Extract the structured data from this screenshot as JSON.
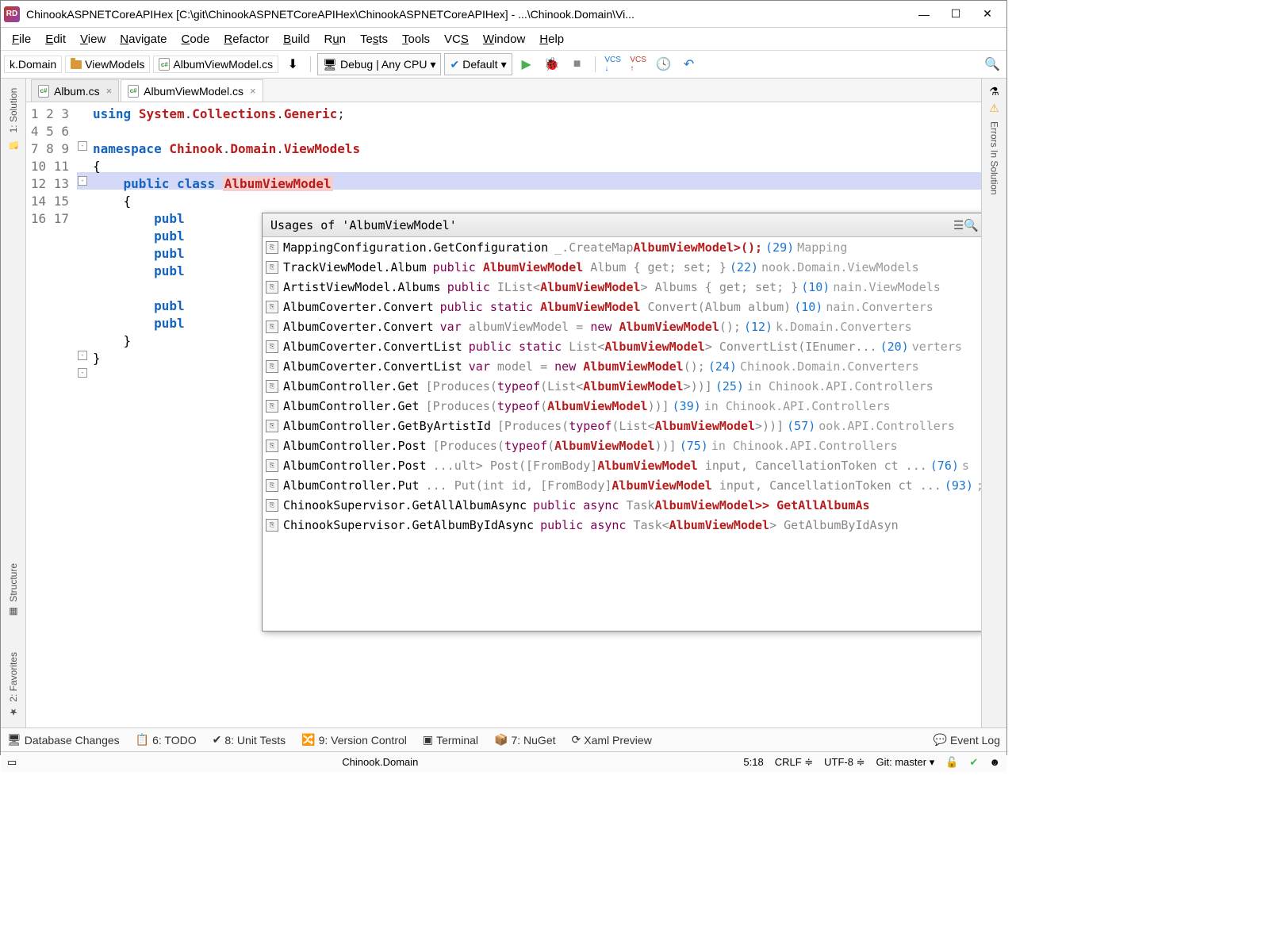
{
  "title": "ChinookASPNETCoreAPIHex [C:\\git\\ChinookASPNETCoreAPIHex\\ChinookASPNETCoreAPIHex] - ...\\Chinook.Domain\\Vi...",
  "menu": {
    "file": "File",
    "edit": "Edit",
    "view": "View",
    "navigate": "Navigate",
    "code": "Code",
    "refactor": "Refactor",
    "build": "Build",
    "run": "Run",
    "tests": "Tests",
    "tools": "Tools",
    "vcs": "VCS",
    "window": "Window",
    "help": "Help"
  },
  "breadcrumbs": {
    "seg1": "k.Domain",
    "seg2": "ViewModels",
    "seg3": "AlbumViewModel.cs"
  },
  "config": {
    "debug": "Debug | Any CPU",
    "default": "Default"
  },
  "tabs": {
    "t1": "Album.cs",
    "t2": "AlbumViewModel.cs"
  },
  "rails": {
    "solution": "1: Solution",
    "structure": "Structure",
    "favorites": "2: Favorites",
    "errors": "Errors In Solution"
  },
  "lines": [
    "1",
    "2",
    "3",
    "4",
    "5",
    "6",
    "7",
    "8",
    "9",
    "10",
    "11",
    "12",
    "13",
    "14",
    "15",
    "16",
    "17"
  ],
  "usages_title": "Usages of 'AlbumViewModel'",
  "usages": [
    {
      "name": "MappingConfiguration.GetConfiguration",
      "code": "_.CreateMap<Album, |AlbumViewModel|>();",
      "ln": "(29)",
      "path": "Mapping"
    },
    {
      "name": "TrackViewModel.Album",
      "code": "public |AlbumViewModel| Album { get; set; }",
      "ln": "(22)",
      "path": "nook.Domain.ViewModels"
    },
    {
      "name": "ArtistViewModel.Albums",
      "code": "public IList<|AlbumViewModel|> Albums { get; set; }",
      "ln": "(10)",
      "path": "nain.ViewModels"
    },
    {
      "name": "AlbumCoverter.Convert",
      "code": "public static |AlbumViewModel| Convert(Album album)",
      "ln": "(10)",
      "path": "nain.Converters"
    },
    {
      "name": "AlbumCoverter.Convert",
      "code": "var albumViewModel = new |AlbumViewModel|();",
      "ln": "(12)",
      "path": "k.Domain.Converters"
    },
    {
      "name": "AlbumCoverter.ConvertList",
      "code": "public static List<|AlbumViewModel|> ConvertList(IEnumer...",
      "ln": "(20)",
      "path": "verters"
    },
    {
      "name": "AlbumCoverter.ConvertList",
      "code": "var model = new |AlbumViewModel|();",
      "ln": "(24)",
      "path": "Chinook.Domain.Converters"
    },
    {
      "name": "AlbumController.Get",
      "code": "[Produces(typeof(List<|AlbumViewModel|>))]",
      "ln": "(25)",
      "path": "in Chinook.API.Controllers"
    },
    {
      "name": "AlbumController.Get",
      "code": "[Produces(typeof(|AlbumViewModel|))]",
      "ln": "(39)",
      "path": "in Chinook.API.Controllers"
    },
    {
      "name": "AlbumController.GetByArtistId",
      "code": "[Produces(typeof(List<|AlbumViewModel|>))]",
      "ln": "(57)",
      "path": "ook.API.Controllers"
    },
    {
      "name": "AlbumController.Post",
      "code": "[Produces(typeof(|AlbumViewModel|))]",
      "ln": "(75)",
      "path": "in Chinook.API.Controllers"
    },
    {
      "name": "AlbumController.Post",
      "code": "...ult> Post([FromBody]|AlbumViewModel| input, CancellationToken ct ...",
      "ln": "(76)",
      "path": "s"
    },
    {
      "name": "AlbumController.Put",
      "code": "... Put(int id, [FromBody]|AlbumViewModel| input, CancellationToken ct ...",
      "ln": "(93)",
      "path": ";"
    },
    {
      "name": "ChinookSupervisor.GetAllAlbumAsync",
      "code": "public async Task<List<|AlbumViewModel|>> GetAllAlbumAs",
      "ln": "",
      "path": ""
    },
    {
      "name": "ChinookSupervisor.GetAlbumByIdAsync",
      "code": "public async Task<|AlbumViewModel|> GetAlbumByIdAsyn",
      "ln": "",
      "path": ""
    }
  ],
  "toolwins": {
    "db": "Database Changes",
    "todo": "6: TODO",
    "unit": "8: Unit Tests",
    "vc": "9: Version Control",
    "term": "Terminal",
    "nuget": "7: NuGet",
    "xaml": "Xaml Preview",
    "event": "Event Log"
  },
  "status": {
    "module": "Chinook.Domain",
    "pos": "5:18",
    "crlf": "CRLF",
    "enc": "UTF-8",
    "branch": "Git: master"
  }
}
